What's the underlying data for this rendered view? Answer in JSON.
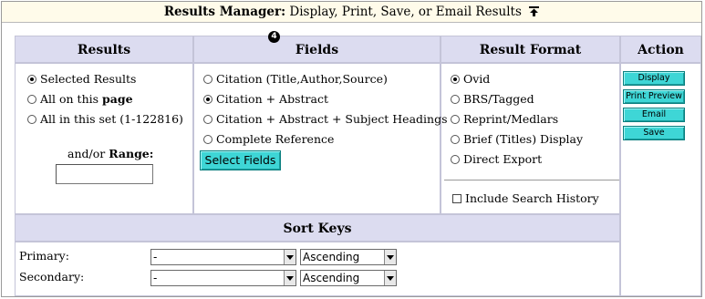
{
  "title": {
    "bold": "Results Manager:",
    "rest": " Display, Print, Save, or Email Results"
  },
  "headers": {
    "results": "Results",
    "fields_marker": "4",
    "fields": "Fields",
    "result_format": "Result Format",
    "action": "Action",
    "sort_keys": "Sort Keys"
  },
  "results": {
    "options": [
      {
        "label": "Selected Results",
        "selected": true
      },
      {
        "label_prefix": "All on this ",
        "label_bold": "page",
        "selected": false
      },
      {
        "label": "All in this set (1-122816)",
        "selected": false
      }
    ],
    "range_prefix": "and/or ",
    "range_label": "Range:",
    "range_value": ""
  },
  "fields": {
    "options": [
      {
        "label": "Citation (Title,Author,Source)",
        "selected": false
      },
      {
        "label": "Citation + Abstract",
        "selected": true
      },
      {
        "label": "Citation + Abstract + Subject Headings",
        "selected": false
      },
      {
        "label": "Complete Reference",
        "selected": false
      }
    ],
    "select_button": "Select Fields"
  },
  "format": {
    "options": [
      {
        "label": "Ovid",
        "selected": true
      },
      {
        "label": "BRS/Tagged",
        "selected": false
      },
      {
        "label": "Reprint/Medlars",
        "selected": false
      },
      {
        "label": "Brief (Titles) Display",
        "selected": false
      },
      {
        "label": "Direct Export",
        "selected": false
      }
    ],
    "include_history": "Include Search History",
    "include_history_checked": false
  },
  "actions": [
    "Display",
    "Print Preview",
    "Email",
    "Save"
  ],
  "sort": {
    "primary_label": "Primary:",
    "secondary_label": "Secondary:",
    "primary_field": "-",
    "secondary_field": "-",
    "primary_order": "Ascending",
    "secondary_order": "Ascending"
  },
  "colors": {
    "header_bg": "#dcdcf0",
    "title_bg": "#fffbea",
    "button_bg": "#3ed6d6"
  }
}
